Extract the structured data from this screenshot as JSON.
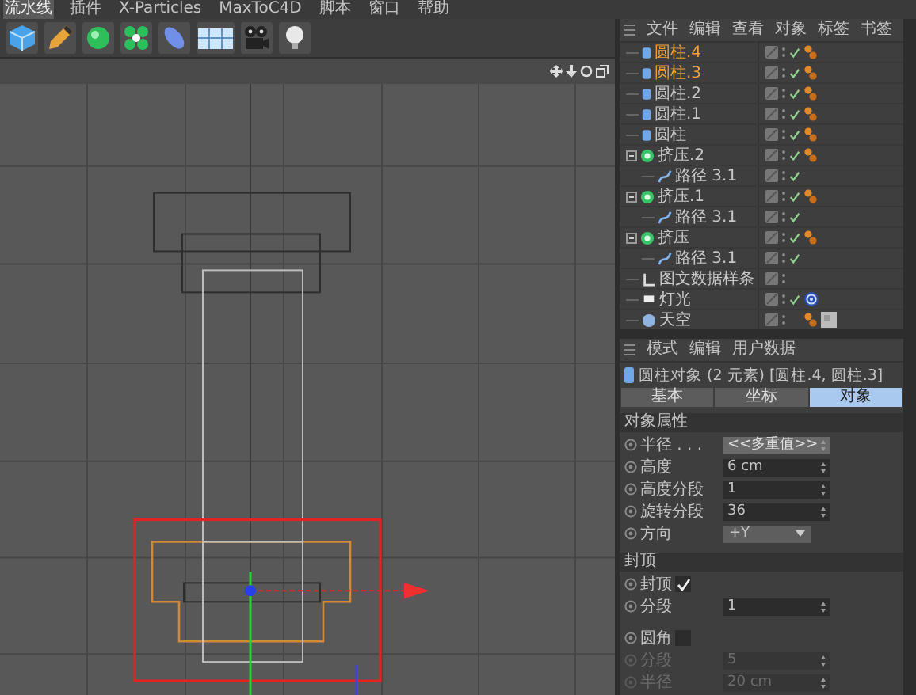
{
  "menu": [
    {
      "label": "流水线",
      "selected": true
    },
    {
      "label": "插件",
      "selected": false
    },
    {
      "label": "X-Particles",
      "selected": false
    },
    {
      "label": "MaxToC4D",
      "selected": false
    },
    {
      "label": "脚本",
      "selected": false
    },
    {
      "label": "窗口",
      "selected": false
    },
    {
      "label": "帮助",
      "selected": false
    }
  ],
  "object_manager": {
    "menu": [
      "文件",
      "编辑",
      "查看",
      "对象",
      "标签",
      "书签"
    ],
    "objects": [
      {
        "name": "圆柱.4",
        "kind": "cylinder",
        "selected": true,
        "checked": true,
        "tags": [
          {
            "kind": "material"
          }
        ]
      },
      {
        "name": "圆柱.3",
        "kind": "cylinder",
        "selected": true,
        "checked": true,
        "tags": [
          {
            "kind": "material"
          }
        ]
      },
      {
        "name": "圆柱.2",
        "kind": "cylinder",
        "selected": false,
        "checked": true,
        "tags": [
          {
            "kind": "material"
          }
        ]
      },
      {
        "name": "圆柱.1",
        "kind": "cylinder",
        "selected": false,
        "checked": true,
        "tags": [
          {
            "kind": "material"
          }
        ]
      },
      {
        "name": "圆柱",
        "kind": "cylinder",
        "selected": false,
        "checked": true,
        "tags": [
          {
            "kind": "material"
          }
        ]
      },
      {
        "name": "挤压.2",
        "kind": "extrude",
        "selected": false,
        "checked": true,
        "tags": [
          {
            "kind": "material"
          }
        ],
        "expanded": true,
        "children": [
          {
            "name": "路径 3.1",
            "kind": "spline",
            "selected": false,
            "checked": true
          }
        ]
      },
      {
        "name": "挤压.1",
        "kind": "extrude",
        "selected": false,
        "checked": true,
        "tags": [
          {
            "kind": "material"
          }
        ],
        "expanded": true,
        "children": [
          {
            "name": "路径 3.1",
            "kind": "spline",
            "selected": false,
            "checked": true
          }
        ]
      },
      {
        "name": "挤压",
        "kind": "extrude",
        "selected": false,
        "checked": true,
        "tags": [
          {
            "kind": "material"
          }
        ],
        "expanded": true,
        "children": [
          {
            "name": "路径 3.1",
            "kind": "spline",
            "selected": false,
            "checked": true
          }
        ]
      },
      {
        "name": "图文数据样条",
        "kind": "text",
        "selected": false,
        "checked": false
      },
      {
        "name": "灯光",
        "kind": "light",
        "selected": false,
        "checked": true,
        "tags": [
          {
            "kind": "target"
          }
        ]
      },
      {
        "name": "天空",
        "kind": "sky",
        "selected": false,
        "checked": false,
        "tags": [
          {
            "kind": "material"
          },
          {
            "kind": "texture"
          }
        ]
      }
    ]
  },
  "attributes": {
    "menu": [
      "模式",
      "编辑",
      "用户数据"
    ],
    "title": "圆柱对象 (2 元素) [圆柱.4, 圆柱.3]",
    "tabs": [
      {
        "label": "基本",
        "selected": false
      },
      {
        "label": "坐标",
        "selected": false
      },
      {
        "label": "对象",
        "selected": true
      }
    ],
    "sections": [
      {
        "title": "对象属性",
        "props": [
          {
            "kind": "field",
            "label": "半径 . . .",
            "value": "<<多重值>>",
            "mixed": true,
            "disabled": false
          },
          {
            "kind": "field",
            "label": "高度",
            "value": "6 cm",
            "mixed": false,
            "disabled": false
          },
          {
            "kind": "field",
            "label": "高度分段",
            "value": "1",
            "mixed": false,
            "disabled": false
          },
          {
            "kind": "field",
            "label": "旋转分段",
            "value": "36",
            "mixed": false,
            "disabled": false
          },
          {
            "kind": "dropdown",
            "label": "方向",
            "value": "+Y",
            "disabled": false
          }
        ]
      },
      {
        "title": "封顶",
        "props": [
          {
            "kind": "checkbox",
            "label": "封顶",
            "checked": true,
            "disabled": false
          },
          {
            "kind": "field",
            "label": "分段",
            "value": "1",
            "mixed": false,
            "disabled": false
          },
          {
            "kind": "checkbox",
            "label": "圆角",
            "checked": false,
            "disabled": false,
            "gap": true
          },
          {
            "kind": "field",
            "label": "分段",
            "value": "5",
            "mixed": false,
            "disabled": true
          },
          {
            "kind": "field",
            "label": "半径",
            "value": "20 cm",
            "mixed": false,
            "disabled": true
          }
        ]
      }
    ]
  }
}
